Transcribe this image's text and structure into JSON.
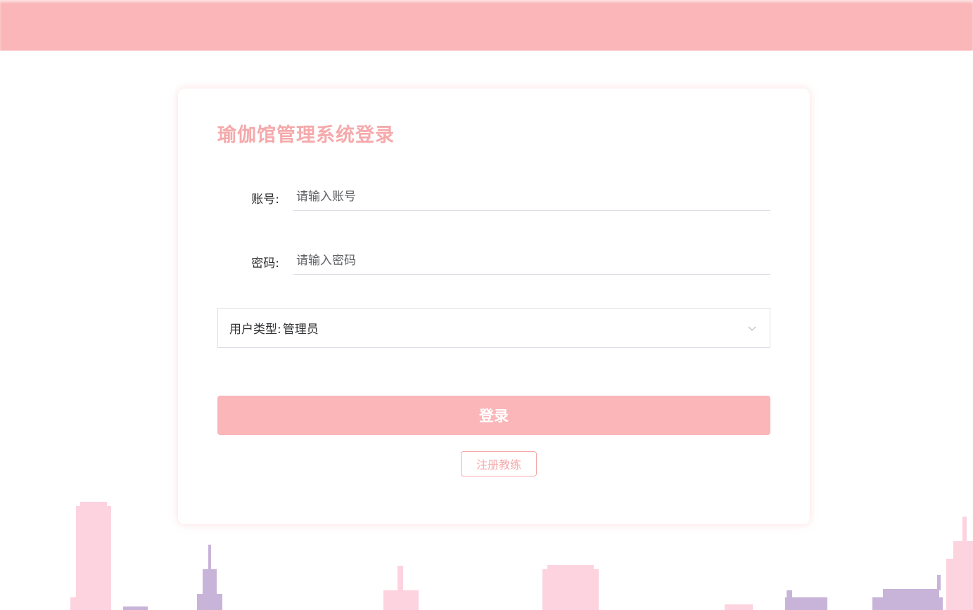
{
  "login": {
    "title": "瑜伽馆管理系统登录",
    "account_label": "账号:",
    "account_placeholder": "请输入账号",
    "password_label": "密码:",
    "password_placeholder": "请输入密码",
    "user_type_label": "用户类型:",
    "user_type_value": "管理员",
    "login_button": "登录",
    "register_button": "注册教练"
  },
  "colors": {
    "accent": "#fab6b8",
    "accent_text": "#f5a9ab",
    "skyline_pink": "#fcd3de",
    "skyline_purple": "#c8b4d9"
  },
  "icons": {
    "select_arrow": "chevron-down-icon"
  }
}
